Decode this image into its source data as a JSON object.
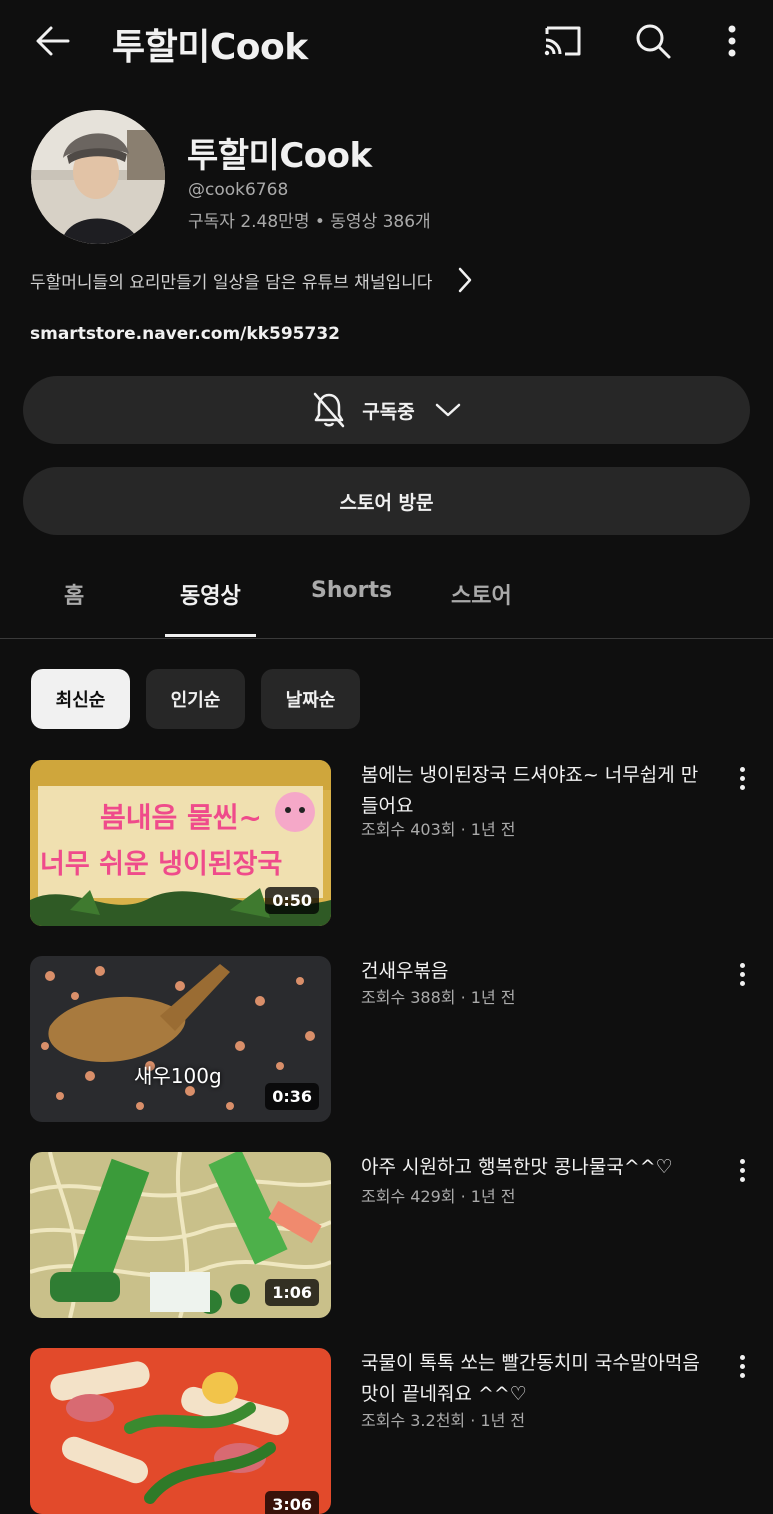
{
  "header": {
    "title": "투할미Cook",
    "icons": [
      "back-arrow-icon",
      "cast-icon",
      "search-icon",
      "more-vert-icon"
    ]
  },
  "channel": {
    "name": "투할미Cook",
    "handle": "@cook6768",
    "stats": "구독자 2.48만명 • 동영상 386개",
    "description": "두할머니들의 요리만들기 일상을 담은 유튜브 채널입니다",
    "link": "smartstore.naver.com/kk595732"
  },
  "buttons": {
    "subscribed": "구독중",
    "store": "스토어 방문"
  },
  "tabs": [
    {
      "label": "홈"
    },
    {
      "label": "동영상"
    },
    {
      "label": "Shorts"
    },
    {
      "label": "스토어"
    }
  ],
  "active_tab": "동영상",
  "chips": [
    {
      "label": "최신순"
    },
    {
      "label": "인기순"
    },
    {
      "label": "날짜순"
    }
  ],
  "selected_chip": "최신순",
  "videos": [
    {
      "title": "봄에는 냉이된장국 드셔야죠~ 너무쉽게 만들어요",
      "meta": "조회수 403회 · 1년 전",
      "duration": "0:50",
      "thumb_text_1": "봄내음 물씬~",
      "thumb_text_2": "너무 쉬운 냉이된장국"
    },
    {
      "title": "건새우볶음",
      "meta": "조회수 388회 · 1년 전",
      "duration": "0:36",
      "thumb_text_1": "새우100g"
    },
    {
      "title": "아주 시원하고 행복한맛 콩나물국^^♡",
      "meta": "조회수 429회 · 1년 전",
      "duration": "1:06"
    },
    {
      "title": "국물이 톡톡 쏘는 빨간동치미 국수말아먹음 맛이 끝네줘요 ^^♡",
      "meta": "조회수 3.2천회 · 1년 전",
      "duration": "3:06"
    }
  ],
  "colors": {
    "background": "#0f0f0f",
    "surface": "#272727",
    "text": "#f1f1f1",
    "secondary_text": "#aaaaaa"
  }
}
